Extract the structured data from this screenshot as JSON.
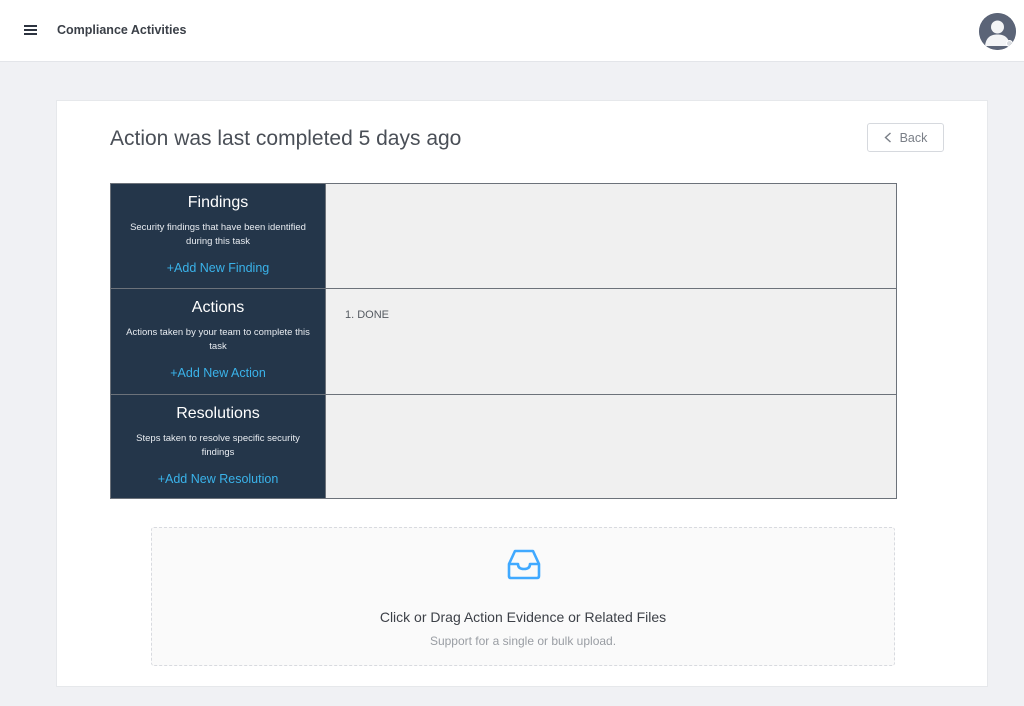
{
  "header": {
    "title": "Compliance Activities",
    "menu_icon": "menu-icon",
    "avatar_icon": "user-avatar-icon"
  },
  "page": {
    "title": "Action was last completed 5 days ago",
    "back_label": "Back",
    "back_icon": "chevron-left-icon"
  },
  "sections": [
    {
      "title": "Findings",
      "description": "Security findings that have been identified during this task",
      "add_label": "Add New Finding",
      "items": []
    },
    {
      "title": "Actions",
      "description": "Actions taken by your team to complete this task",
      "add_label": "Add New Action",
      "items": [
        "1. DONE"
      ]
    },
    {
      "title": "Resolutions",
      "description": "Steps taken to resolve specific security findings",
      "add_label": "Add New Resolution",
      "items": []
    }
  ],
  "upload": {
    "icon": "inbox-icon",
    "title": "Click or Drag Action Evidence or Related Files",
    "hint": "Support for a single or bulk upload."
  },
  "colors": {
    "label_bg": "#24364a",
    "accent": "#3ab3ea",
    "content_bg": "#f0f0f0",
    "page_bg": "#f0f1f4"
  }
}
